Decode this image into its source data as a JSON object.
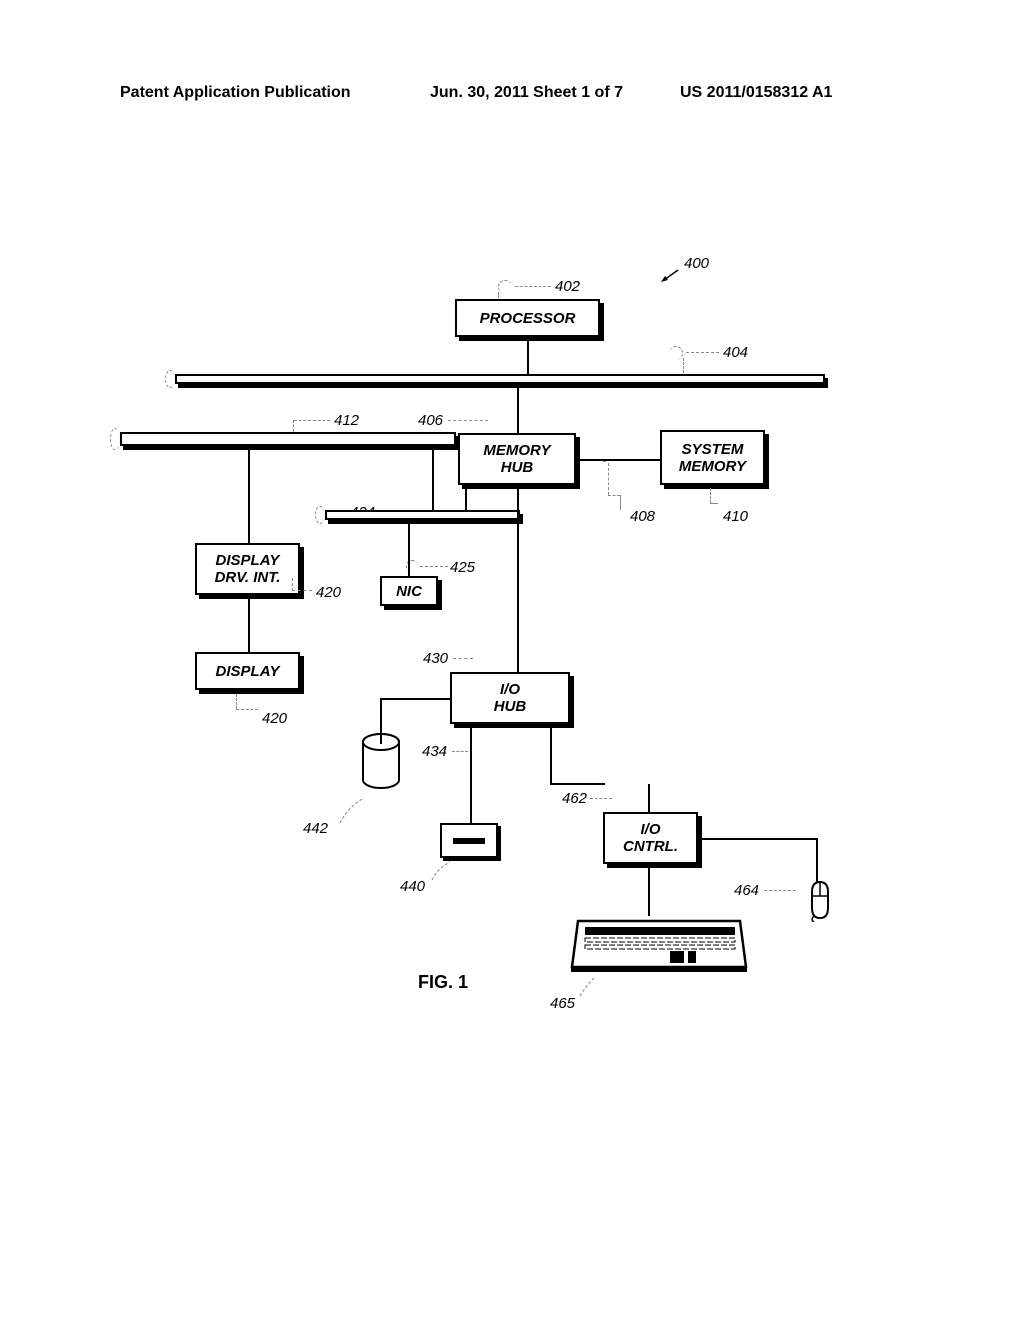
{
  "header": {
    "left": "Patent Application Publication",
    "center": "Jun. 30, 2011  Sheet 1 of 7",
    "right": "US 2011/0158312 A1"
  },
  "blocks": {
    "processor": "PROCESSOR",
    "memory_hub": "MEMORY\nHUB",
    "system_memory": "SYSTEM\nMEMORY",
    "display_drv": "DISPLAY\nDRV. INT.",
    "nic": "NIC",
    "display": "DISPLAY",
    "io_hub": "I/O\nHUB",
    "io_cntrl": "I/O\nCNTRL."
  },
  "refs": {
    "r400": "400",
    "r402": "402",
    "r404": "404",
    "r406": "406",
    "r408": "408",
    "r410": "410",
    "r412": "412",
    "r420a": "420",
    "r420b": "420",
    "r424": "424",
    "r425": "425",
    "r430": "430",
    "r434": "434",
    "r440": "440",
    "r442": "442",
    "r462": "462",
    "r464": "464",
    "r465": "465"
  },
  "figure": "FIG. 1"
}
